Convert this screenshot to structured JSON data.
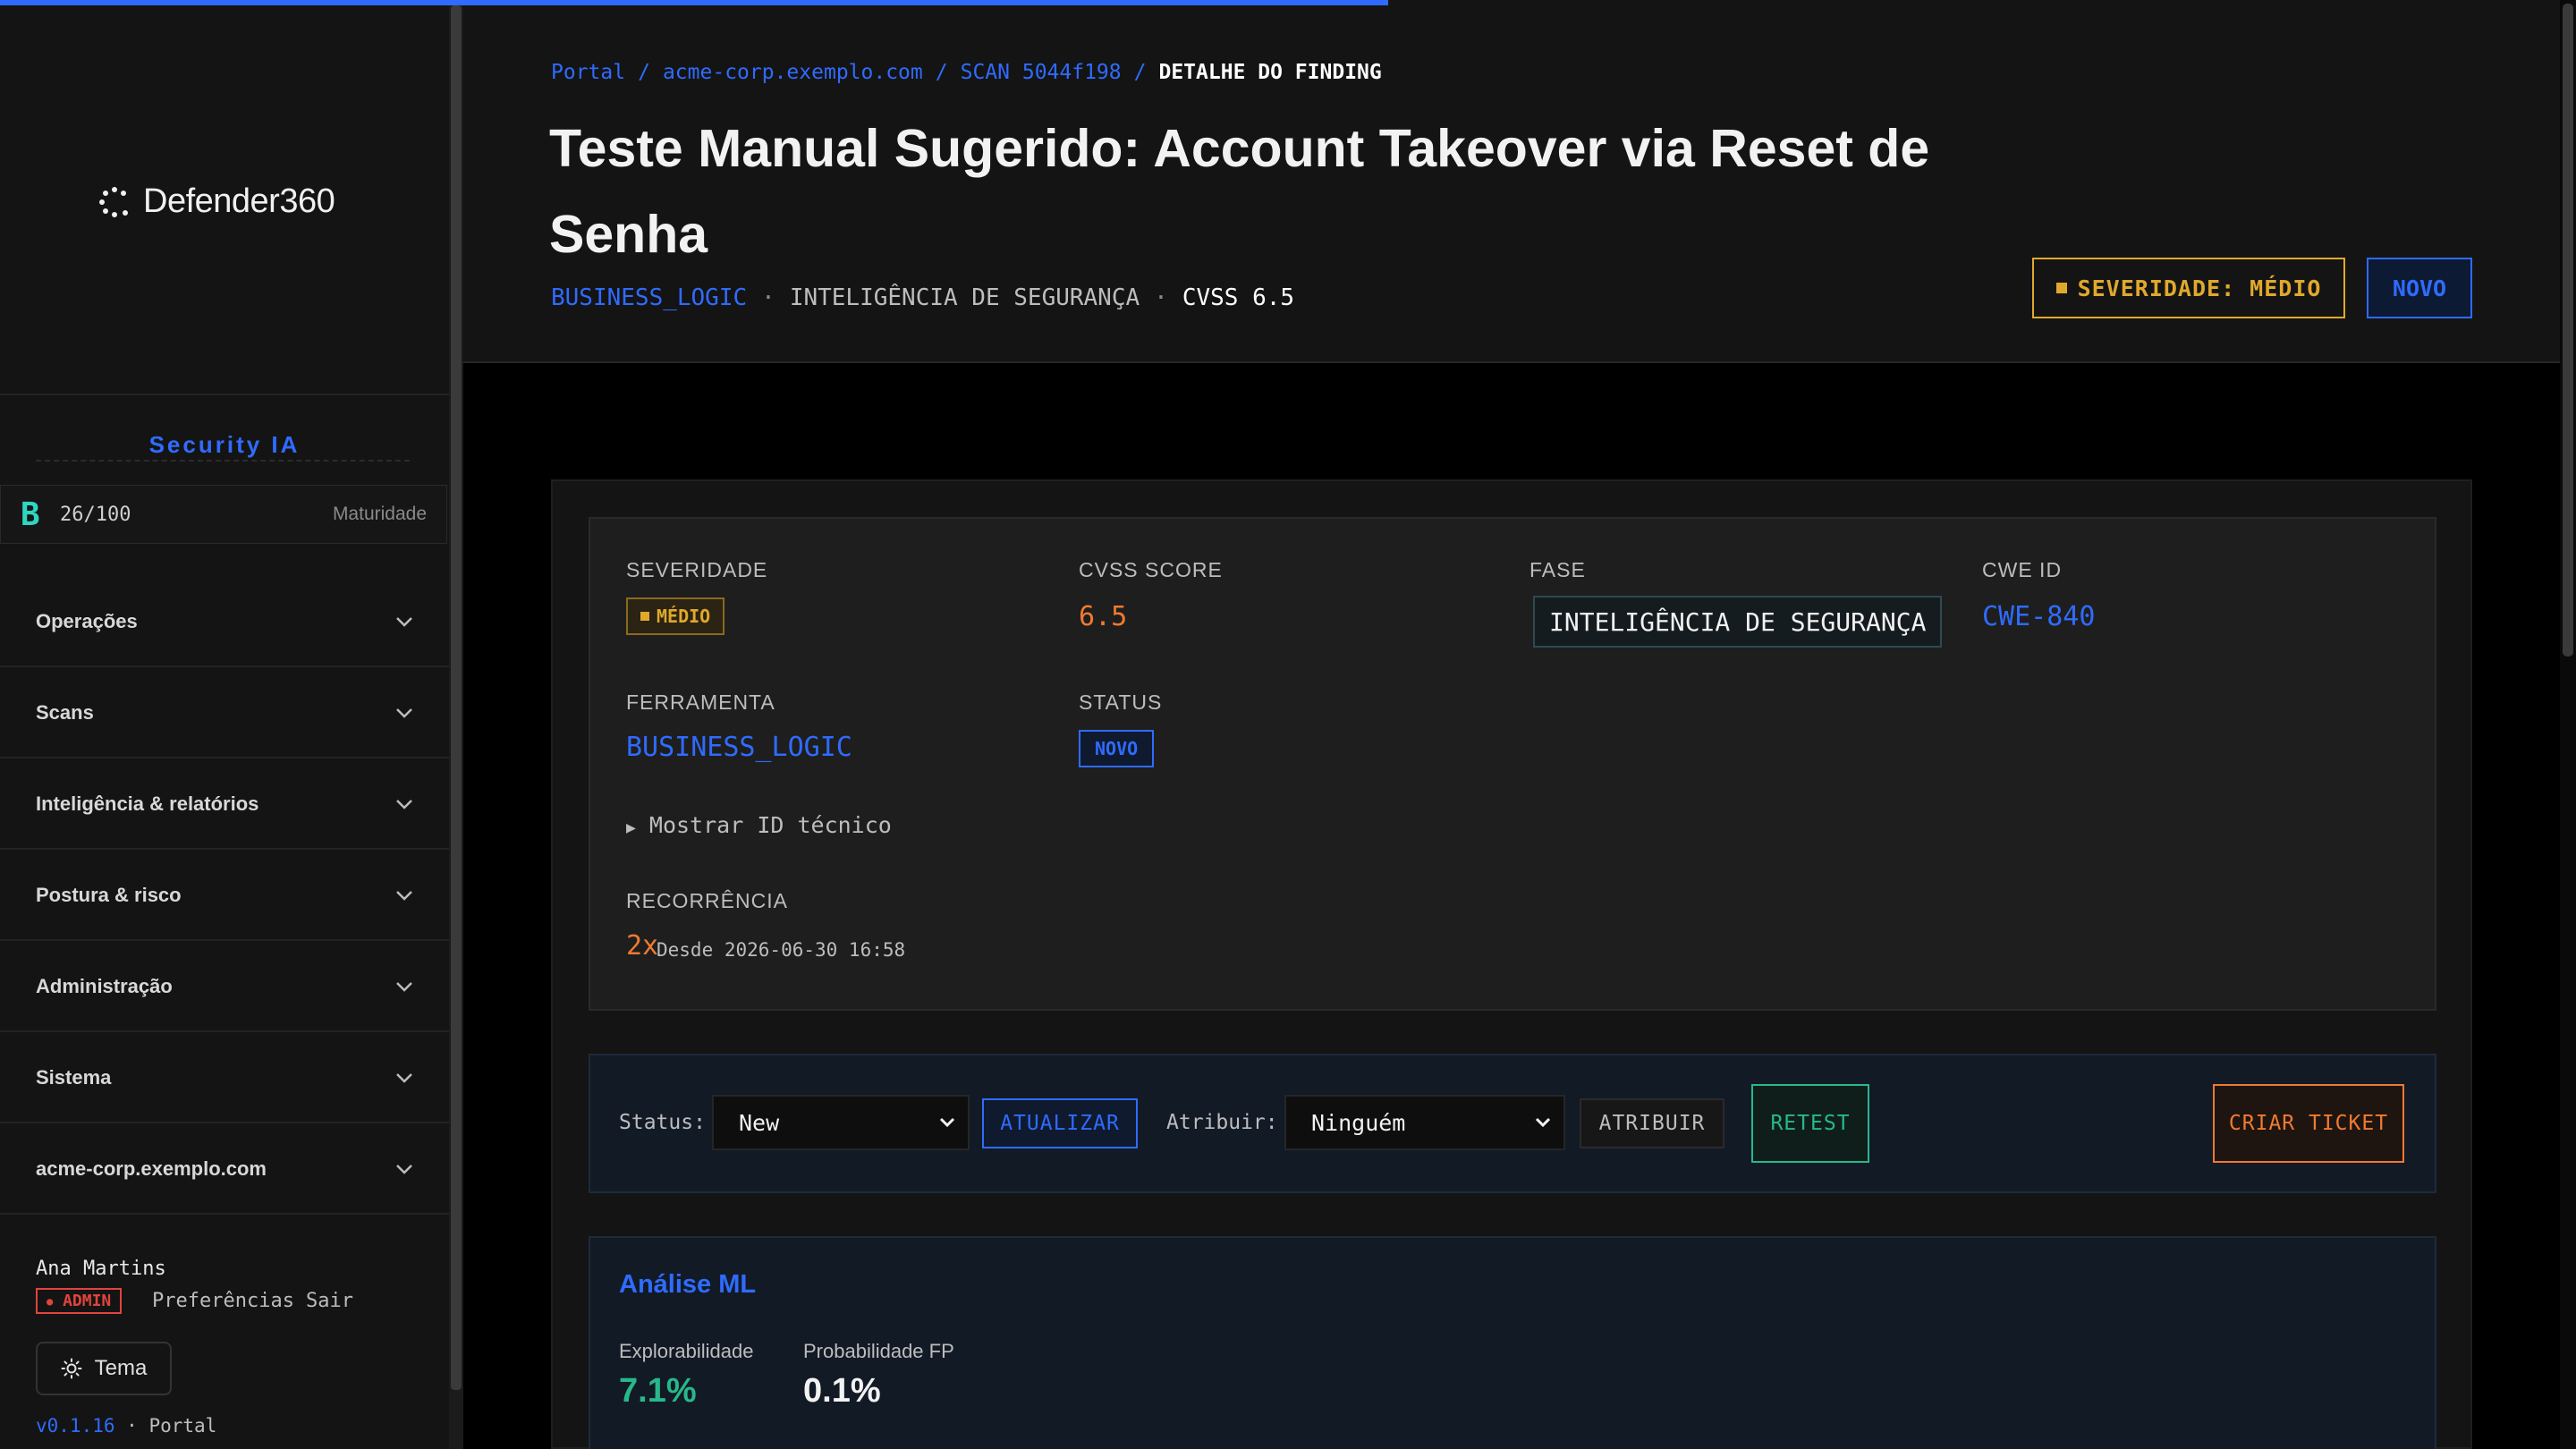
{
  "brand": {
    "name": "Defender360"
  },
  "sidebar": {
    "ai_title": "Security IA",
    "maturity": {
      "grade": "B",
      "score": "26/100",
      "label": "Maturidade"
    },
    "items": [
      {
        "label": "Operações"
      },
      {
        "label": "Scans"
      },
      {
        "label": "Inteligência & relatórios"
      },
      {
        "label": "Postura & risco"
      },
      {
        "label": "Administração"
      },
      {
        "label": "Sistema"
      },
      {
        "label": "acme-corp.exemplo.com"
      }
    ],
    "user": {
      "name": "Ana Martins",
      "role": "ADMIN",
      "prefs": "Preferências",
      "logout": "Sair"
    },
    "theme_label": "Tema",
    "version": "v0.1.16",
    "version_suffix": "· Portal"
  },
  "breadcrumb": {
    "portal": "Portal",
    "target": "acme-corp.exemplo.com",
    "scan": "SCAN 5044f198",
    "current": "DETALHE DO FINDING"
  },
  "page": {
    "title": "Teste Manual Sugerido: Account Takeover via Reset de Senha",
    "tool": "BUSINESS_LOGIC",
    "phase": "INTELIGÊNCIA DE SEGURANÇA",
    "cvss": "CVSS 6.5",
    "severity_badge": "SEVERIDADE: MÉDIO",
    "status_badge": "NOVO"
  },
  "details": {
    "severidade_label": "SEVERIDADE",
    "severidade_value": "MÉDIO",
    "cvss_label": "CVSS SCORE",
    "cvss_value": "6.5",
    "fase_label": "FASE",
    "fase_value": "INTELIGÊNCIA DE SEGURANÇA",
    "cwe_label": "CWE ID",
    "cwe_value": "CWE-840",
    "ferramenta_label": "FERRAMENTA",
    "ferramenta_value": "BUSINESS_LOGIC",
    "status_label": "STATUS",
    "status_value": "NOVO",
    "tech_id_toggle": "Mostrar ID técnico",
    "recorrencia_label": "RECORRÊNCIA",
    "recorrencia_count": "2x",
    "recorrencia_since": "Desde 2026-06-30 16:58"
  },
  "actions": {
    "status_label": "Status:",
    "status_selected": "New",
    "update_button": "ATUALIZAR",
    "assign_label": "Atribuir:",
    "assign_selected": "Ninguém",
    "assign_button": "ATRIBUIR",
    "retest_button": "RETEST",
    "ticket_button": "CRIAR TICKET"
  },
  "ml": {
    "title": "Análise ML",
    "explorability_label": "Explorabilidade",
    "explorability_value": "7.1%",
    "fp_label": "Probabilidade FP",
    "fp_value": "0.1%"
  },
  "colors": {
    "accent": "#2f6bff",
    "medium": "#e0a92b",
    "orange": "#f07a30",
    "green": "#27b88a",
    "teal": "#2fd6c2",
    "danger": "#e0443e"
  }
}
